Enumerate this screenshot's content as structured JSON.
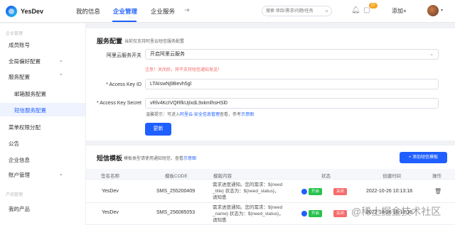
{
  "brand": {
    "name": "YesDev"
  },
  "nav": {
    "items": [
      "我的信息",
      "企业管理",
      "企业服务"
    ],
    "active": "企业管理"
  },
  "header": {
    "search_placeholder": "搜索 项目/需求/问题/任务",
    "notification_count": "27",
    "add_label": "添加+"
  },
  "sidebar": {
    "section1": "企业管理",
    "items": {
      "members": "成员账号",
      "global_prefs": "全局偏好配置",
      "service_config": "服务配置",
      "mail_config": "邮箱服务配置",
      "sms_config": "短信服务配置",
      "menu_perm": "菜单权限分配",
      "notice": "公告",
      "company_info": "企业信息",
      "billing": "账户管理"
    },
    "section2": "产品管理",
    "my_products": "我的产品"
  },
  "service": {
    "title": "服务配置",
    "subtitle": "当前仅支持阿里云短信服务配置",
    "switch_label": "阿里云服务开关",
    "switch_value": "开启阿里云服务",
    "switch_warning": "注意！关闭后，将不支持短信通知发送！",
    "key_id_label": "* Access Key ID",
    "key_id_value": "LTAIswNj9Bevh5gl",
    "key_secret_label": "* Access Key Secret",
    "key_secret_value": "vRlv4KcIVQRfkUjIxdL9xkmlhsHSl0",
    "hint_prefix": "温馨提示：可进入",
    "hint_link1": "阿里云-安全信息管理",
    "hint_mid": "查看，参考",
    "hint_link2": "示意图",
    "update_button": "更新"
  },
  "sms": {
    "title": "短信模板",
    "subtitle_prefix": "模板类型请使用通知短信，查看",
    "subtitle_link": "示意图",
    "add_button": "+ 添加短信模板",
    "columns": [
      "签名名称",
      "模板CODE",
      "模版内容",
      "状态",
      "创建时间",
      "操作"
    ],
    "rows": [
      {
        "sign": "YesDev",
        "code": "SMS_255200409",
        "content": [
          "需求进度通知。您的需求：${need",
          "_title} 状态为：${need_status}，",
          "请知悉"
        ],
        "on": "开启",
        "off": "关闭",
        "created": "2022-10-26 10:13:18"
      },
      {
        "sign": "YesDev",
        "code": "SMS_256085053",
        "content": [
          "需求进度通知。您的需求：${need",
          "_name} 状态为：${need_status}，",
          "请知悉"
        ],
        "on": "开启",
        "off": "关闭",
        "created": "2022-10-26 10:13:18"
      }
    ]
  },
  "watermark": "@稀土掘金技术社区",
  "colors": {
    "accent": "#1f5fff",
    "success": "#27c24c",
    "danger": "#f56c6c"
  }
}
